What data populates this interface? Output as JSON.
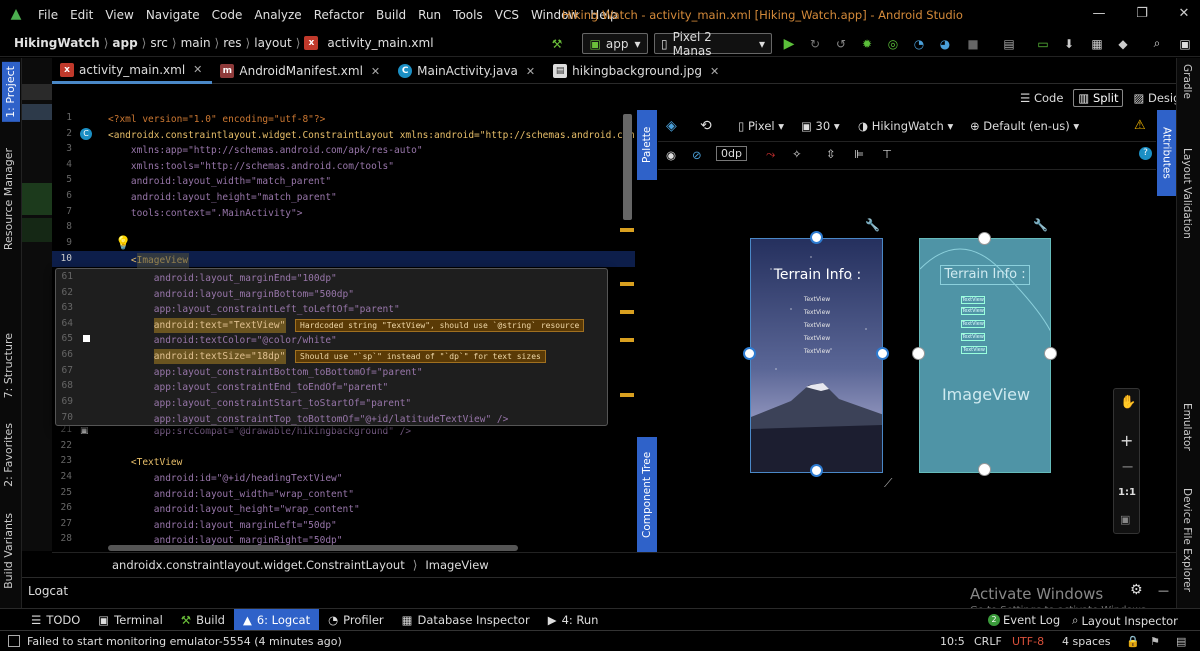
{
  "menubar": {
    "items": [
      "File",
      "Edit",
      "View",
      "Navigate",
      "Code",
      "Analyze",
      "Refactor",
      "Build",
      "Run",
      "Tools",
      "VCS",
      "Window",
      "Help"
    ],
    "title": "Hiking Watch - activity_main.xml [Hiking_Watch.app] - Android Studio"
  },
  "navbar": {
    "breadcrumbs": [
      "HikingWatch",
      "app",
      "src",
      "main",
      "res",
      "layout",
      "activity_main.xml"
    ],
    "run_config": "app",
    "device": "Pixel 2 Manas"
  },
  "tabs": [
    {
      "label": "activity_main.xml",
      "icon": "layout-file-icon",
      "active": true
    },
    {
      "label": "AndroidManifest.xml",
      "icon": "manifest-file-icon",
      "active": false
    },
    {
      "label": "MainActivity.java",
      "icon": "java-class-icon",
      "active": false
    },
    {
      "label": "hikingbackground.jpg",
      "icon": "image-file-icon",
      "active": false
    }
  ],
  "view_modes": {
    "code": "Code",
    "split": "Split",
    "design": "Design"
  },
  "left_tools": [
    "1: Project",
    "Resource Manager",
    "7: Structure",
    "2: Favorites",
    "Build Variants"
  ],
  "right_tools": [
    "Gradle",
    "Layout Validation",
    "Emulator",
    "Device File Explorer"
  ],
  "side_tabs": {
    "palette": "Palette",
    "component_tree": "Component Tree",
    "attributes": "Attributes"
  },
  "code_lines": [
    {
      "n": "1",
      "text": "<?xml version=\"1.0\" encoding=\"utf-8\"?>"
    },
    {
      "n": "2",
      "text": "<androidx.constraintlayout.widget.ConstraintLayout xmlns:android=\"http://schemas.android.com"
    },
    {
      "n": "3",
      "text": "    xmlns:app=\"http://schemas.android.com/apk/res-auto\""
    },
    {
      "n": "4",
      "text": "    xmlns:tools=\"http://schemas.android.com/tools\""
    },
    {
      "n": "5",
      "text": "    android:layout_width=\"match_parent\""
    },
    {
      "n": "6",
      "text": "    android:layout_height=\"match_parent\""
    },
    {
      "n": "7",
      "text": "    tools:context=\".MainActivity\">"
    },
    {
      "n": "8",
      "text": ""
    },
    {
      "n": "9",
      "text": ""
    },
    {
      "n": "10",
      "text": "    <ImageView"
    },
    {
      "n": "21",
      "text": "        app:srcCompat=\"@drawable/hikingbackground\" />"
    },
    {
      "n": "22",
      "text": ""
    },
    {
      "n": "23",
      "text": "    <TextView"
    },
    {
      "n": "24",
      "text": "        android:id=\"@+id/headingTextView\""
    },
    {
      "n": "25",
      "text": "        android:layout_width=\"wrap_content\""
    },
    {
      "n": "26",
      "text": "        android:layout_height=\"wrap_content\""
    },
    {
      "n": "27",
      "text": "        android:layout_marginLeft=\"50dp\""
    },
    {
      "n": "28",
      "text": "        android:layout_marginRight=\"50dp\""
    }
  ],
  "popup_lines": [
    {
      "n": "61",
      "text": "        android:layout_marginEnd=\"100dp\""
    },
    {
      "n": "62",
      "text": "        android:layout_marginBottom=\"500dp\""
    },
    {
      "n": "63",
      "text": "        app:layout_constraintLeft_toLeftOf=\"parent\""
    },
    {
      "n": "64",
      "text": "        android:text=\"TextView\""
    },
    {
      "n": "65",
      "text": "        android:textColor=\"@color/white\""
    },
    {
      "n": "66",
      "text": "        android:textSize=\"18dp\""
    },
    {
      "n": "67",
      "text": "        app:layout_constraintBottom_toBottomOf=\"parent\""
    },
    {
      "n": "68",
      "text": "        app:layout_constraintEnd_toEndOf=\"parent\""
    },
    {
      "n": "69",
      "text": "        app:layout_constraintStart_toStartOf=\"parent\""
    },
    {
      "n": "70",
      "text": "        app:layout_constraintTop_toBottomOf=\"@+id/latitudeTextView\" />"
    }
  ],
  "warnings": {
    "hardcoded": "Hardcoded string \"TextView\", should use `@string` resource",
    "sp": "Should use \"`sp`\" instead of \"`dp`\" for text sizes"
  },
  "design_toolbar": {
    "device": "Pixel",
    "api": "30",
    "theme": "HikingWatch",
    "locale": "Default (en-us)",
    "margin": "0dp"
  },
  "preview": {
    "heading": "Terrain Info :",
    "textviews": [
      "TextView",
      "TextView",
      "TextView",
      "TextView",
      "TextView"
    ],
    "blueprint_label": "ImageView",
    "zoom_ratio": "1:1"
  },
  "component_breadcrumb": [
    "androidx.constraintlayout.widget.ConstraintLayout",
    "ImageView"
  ],
  "logcat": {
    "title": "Logcat"
  },
  "bottom_tools": [
    {
      "label": "TODO",
      "icon": "list-icon",
      "active": false
    },
    {
      "label": "Terminal",
      "icon": "terminal-icon",
      "active": false
    },
    {
      "label": "Build",
      "icon": "hammer-icon",
      "active": false
    },
    {
      "label": "6: Logcat",
      "icon": "android-icon",
      "active": true
    },
    {
      "label": "Profiler",
      "icon": "profiler-icon",
      "active": false
    },
    {
      "label": "Database Inspector",
      "icon": "database-icon",
      "active": false
    },
    {
      "label": "4: Run",
      "icon": "play-icon",
      "active": false
    }
  ],
  "bottom_right": {
    "event_count": "2",
    "event_log": "Event Log",
    "layout_inspector": "Layout Inspector"
  },
  "status": {
    "message": "Failed to start monitoring emulator-5554 (4 minutes ago)",
    "position": "10:5",
    "line_sep": "CRLF",
    "encoding": "UTF-8",
    "indent": "4 spaces"
  },
  "watermark": {
    "line1": "Activate Windows",
    "line2": "Go to Settings to activate Windows."
  }
}
